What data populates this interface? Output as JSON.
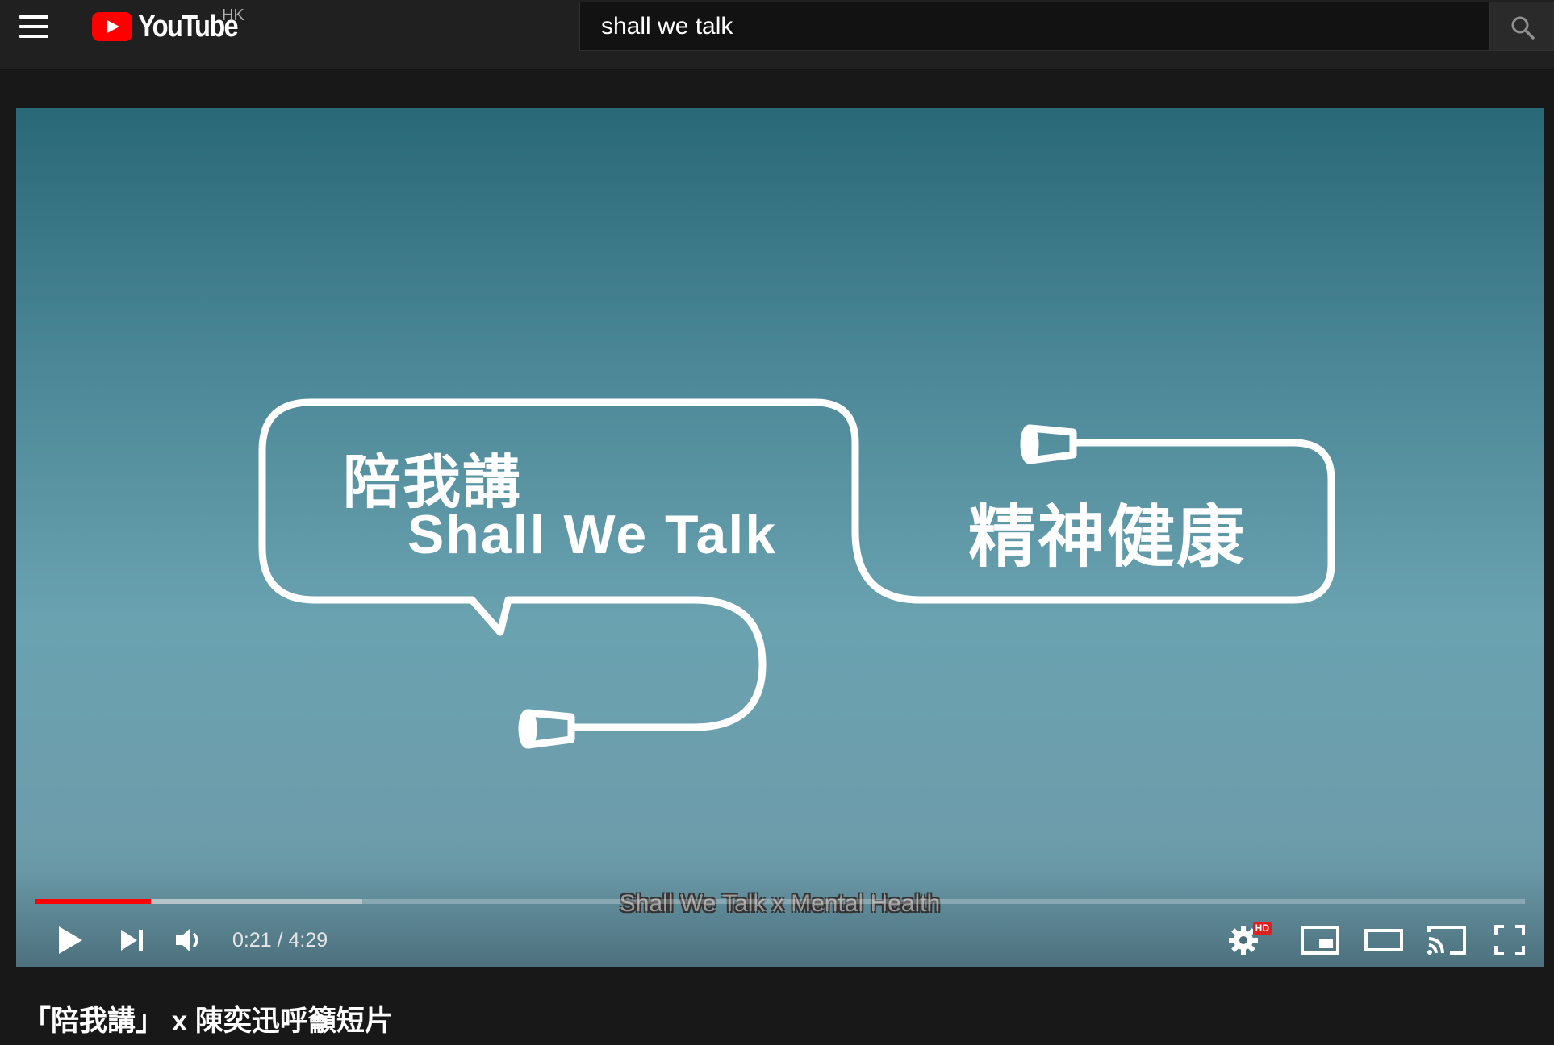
{
  "masthead": {
    "logo_text": "YouTube",
    "region": "HK",
    "search_value": "shall we talk"
  },
  "player": {
    "frame_text": {
      "line1": "陪我講",
      "line2": "Shall We Talk",
      "right": "精神健康"
    },
    "caption": "Shall We Talk x Mental Health",
    "current_time": "0:21",
    "duration": "4:29",
    "time_display": "0:21 / 4:29",
    "progress_played": 0.078,
    "progress_buffered": 0.22,
    "quality_badge": "HD",
    "accent_color": "#ff0000"
  },
  "video": {
    "title": "「陪我講」 x 陳奕迅呼籲短片"
  }
}
